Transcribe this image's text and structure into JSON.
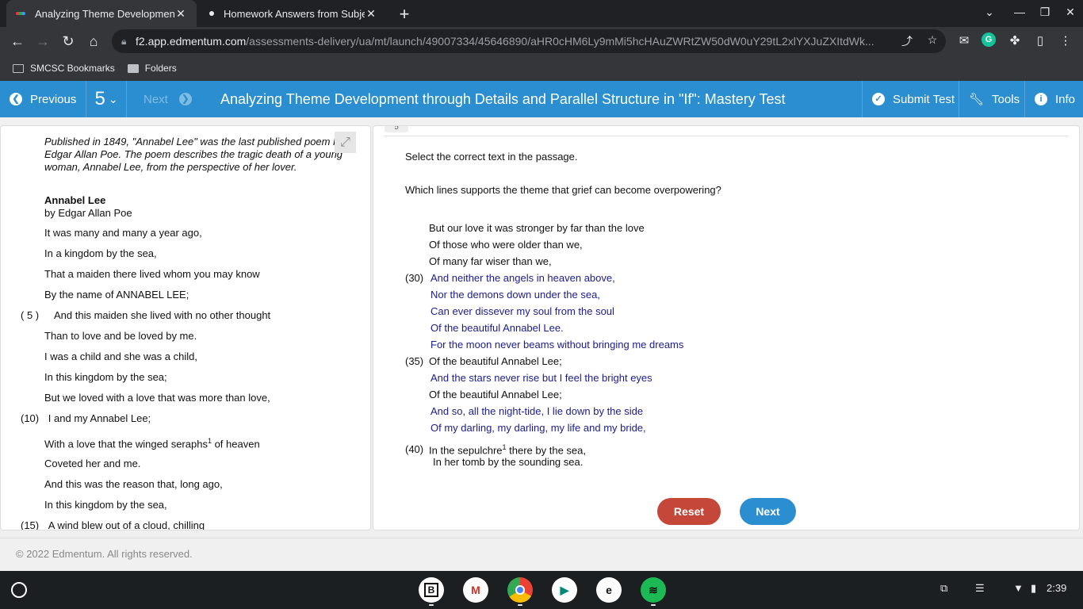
{
  "browser": {
    "tabs": [
      {
        "title": "Analyzing Theme Development t",
        "active": true
      },
      {
        "title": "Homework Answers from Subjec",
        "active": false
      }
    ],
    "url_host": "f2.app.edmentum.com",
    "url_path": "/assessments-delivery/ua/mt/launch/49007334/45646890/aHR0cHM6Ly9mMi5hcHAuZWRtZW50dW0uY29tL2xlYXJuZXItdWk...",
    "bookmarks": [
      "SMCSC Bookmarks",
      "Folders"
    ]
  },
  "header": {
    "previous_label": "Previous",
    "question_number": "5",
    "next_label": "Next",
    "title": "Analyzing Theme Development through Details and Parallel Structure in \"If\": Mastery Test",
    "submit_label": "Submit Test",
    "tools_label": "Tools",
    "info_label": "Info"
  },
  "passage": {
    "intro": "Published in 1849, \"Annabel Lee\" was the last published poem by Edgar Allan Poe. The poem describes the tragic death of a young woman, Annabel Lee, from the perspective of her lover.",
    "title": "Annabel Lee",
    "author": "by Edgar Allan Poe",
    "lines": [
      {
        "n": "",
        "t": "It was many and many a year ago,"
      },
      {
        "n": "",
        "t": "In a kingdom by the sea,"
      },
      {
        "n": "",
        "t": "That a maiden there lived whom you may know"
      },
      {
        "n": "",
        "t": "By the name of ANNABEL LEE;"
      },
      {
        "n": "( 5 )",
        "t": "And this maiden she lived with no other thought"
      },
      {
        "n": "",
        "t": "Than to love and be loved by me."
      },
      {
        "n": "",
        "t": "I was a child and she was a child,"
      },
      {
        "n": "",
        "t": "In this kingdom by the sea;"
      },
      {
        "n": "",
        "t": "But we loved with a love that was more than love,"
      },
      {
        "n": "(10)",
        "t": "I and my Annabel Lee;"
      },
      {
        "n": "",
        "t": "With a love that the winged seraphs",
        "sup": "1",
        "after": " of heaven"
      },
      {
        "n": "",
        "t": "Coveted her and me."
      },
      {
        "n": "",
        "t": "And this was the reason that, long ago,"
      },
      {
        "n": "",
        "t": "In this kingdom by the sea,"
      },
      {
        "n": "(15)",
        "t": "A wind blew out of a cloud, chilling"
      }
    ]
  },
  "question": {
    "tab_mark": "5",
    "instruction": "Select the correct text in the passage.",
    "prompt": "Which lines supports the theme that grief can become overpowering?",
    "lines": [
      {
        "n": "",
        "t": "But our love it was stronger by far than the love",
        "sel": false
      },
      {
        "n": "",
        "t": "Of those who were older than we,",
        "sel": false
      },
      {
        "n": "",
        "t": "Of many far wiser than we,",
        "sel": false
      },
      {
        "n": "(30)",
        "t": "And neither the angels in heaven above,",
        "sel": true
      },
      {
        "n": "",
        "t": "Nor the demons down under the sea,",
        "sel": true
      },
      {
        "n": "",
        "t": "Can ever dissever my soul from the soul",
        "sel": true
      },
      {
        "n": "",
        "t": "Of the beautiful Annabel Lee.",
        "sel": true
      },
      {
        "n": "",
        "t": "For the moon never beams without bringing me dreams",
        "sel": true
      },
      {
        "n": "(35)",
        "t": "Of the beautiful Annabel Lee;",
        "sel": false
      },
      {
        "n": "",
        "t": "And the stars never rise but I feel the bright eyes",
        "sel": true
      },
      {
        "n": "",
        "t": "Of the beautiful Annabel Lee;",
        "sel": false
      },
      {
        "n": "",
        "t": "And so, all the night-tide, I lie down by the side",
        "sel": true
      },
      {
        "n": "",
        "t": "Of my darling, my darling, my life and my bride,",
        "sel": true
      },
      {
        "n": "(40)",
        "t": "In the sepulchre",
        "sup": "1",
        "after": " there by the sea,",
        "sel": false
      },
      {
        "n": "",
        "t": "In her tomb by the sounding sea.",
        "sel": false
      }
    ],
    "reset_label": "Reset",
    "next_label": "Next"
  },
  "footer": "© 2022 Edmentum. All rights reserved.",
  "shelf": {
    "time": "2:39",
    "apps": [
      "bookmark-app-icon",
      "gmail-icon",
      "chrome-icon",
      "meet-icon",
      "edmentum-icon",
      "spotify-icon"
    ]
  },
  "colors": {
    "header_blue": "#2b8ed0",
    "selected_text": "#1c1c8c",
    "reset_red": "#c4473a"
  }
}
